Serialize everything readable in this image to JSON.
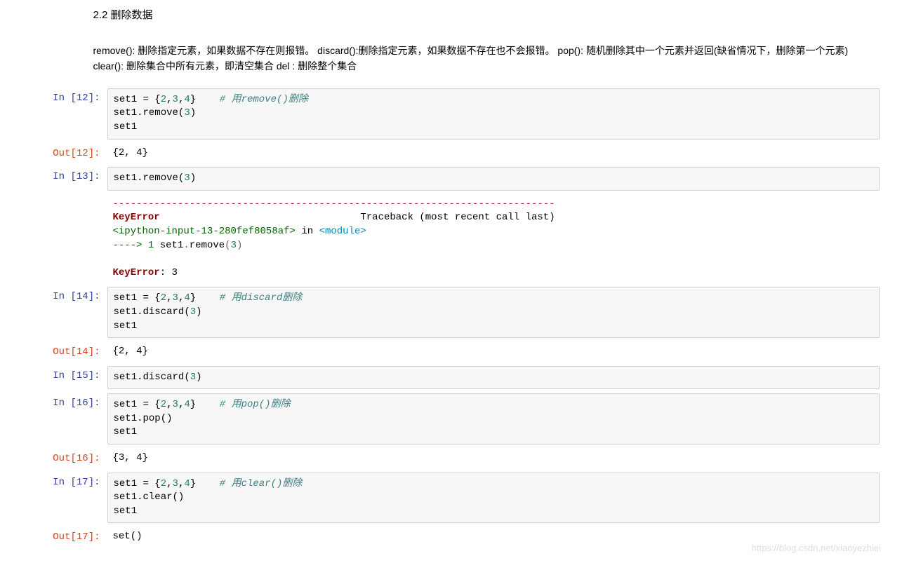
{
  "heading": "2.2 删除数据",
  "description": "remove(): 删除指定元素，如果数据不存在则报错。 discard():删除指定元素，如果数据不存在也不会报错。 pop(): 随机删除其中一个元素并返回(缺省情况下，删除第一个元素) clear(): 删除集合中所有元素，即清空集合 del : 删除整个集合",
  "cells": {
    "in12": {
      "label": "In  [12]:",
      "line1a": "set1 = {",
      "line1b": "2",
      "line1c": ",",
      "line1d": "3",
      "line1e": ",",
      "line1f": "4",
      "line1g": "}    ",
      "comment": "# 用remove()删除",
      "line2a": "set1.remove(",
      "line2b": "3",
      "line2c": ")",
      "line3": "set1"
    },
    "out12": {
      "label": "Out[12]:",
      "text": "{2, 4}"
    },
    "in13": {
      "label": "In  [13]:",
      "line1a": "set1.remove(",
      "line1b": "3",
      "line1c": ")"
    },
    "err13": {
      "sep": "---------------------------------------------------------------------------",
      "name": "KeyError",
      "trace": "                                  Traceback (most recent call last)",
      "loc": "<ipython-input-13-280fef8058af>",
      "in": " in ",
      "mod": "<module>",
      "arrow": "----> 1",
      "call1": " set1",
      "call2": ".",
      "call3": "remove",
      "call4": "(",
      "call5": "3",
      "call6": ")",
      "final": "KeyError",
      "finalmsg": ": 3"
    },
    "in14": {
      "label": "In  [14]:",
      "line1a": "set1 = {",
      "line1b": "2",
      "line1c": ",",
      "line1d": "3",
      "line1e": ",",
      "line1f": "4",
      "line1g": "}    ",
      "comment": "# 用discard删除",
      "line2a": "set1.discard(",
      "line2b": "3",
      "line2c": ")",
      "line3": "set1"
    },
    "out14": {
      "label": "Out[14]:",
      "text": "{2, 4}"
    },
    "in15": {
      "label": "In  [15]:",
      "line1a": "set1.discard(",
      "line1b": "3",
      "line1c": ")"
    },
    "in16": {
      "label": "In  [16]:",
      "line1a": "set1 = {",
      "line1b": "2",
      "line1c": ",",
      "line1d": "3",
      "line1e": ",",
      "line1f": "4",
      "line1g": "}    ",
      "comment": "# 用pop()删除",
      "line2": "set1.pop()",
      "line3": "set1"
    },
    "out16": {
      "label": "Out[16]:",
      "text": "{3, 4}"
    },
    "in17": {
      "label": "In  [17]:",
      "line1a": "set1 = {",
      "line1b": "2",
      "line1c": ",",
      "line1d": "3",
      "line1e": ",",
      "line1f": "4",
      "line1g": "}    ",
      "comment": "# 用clear()删除",
      "line2": "set1.clear()",
      "line3": "set1"
    },
    "out17": {
      "label": "Out[17]:",
      "text": "set()"
    }
  },
  "watermark": "https://blog.csdn.net/xiaoyezhiei"
}
